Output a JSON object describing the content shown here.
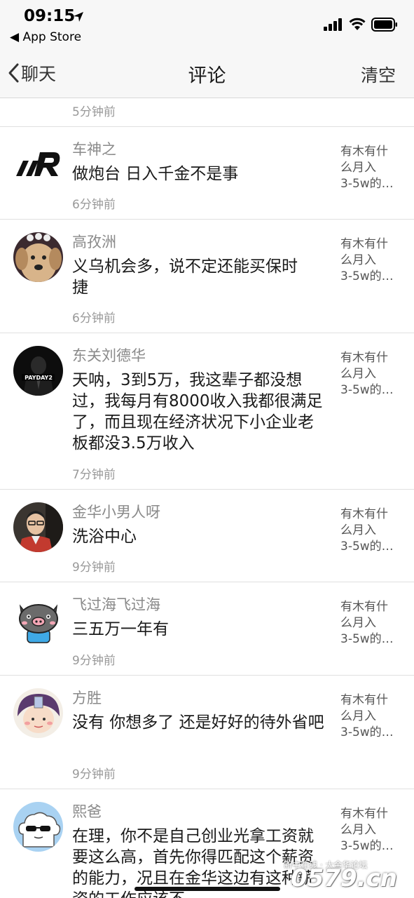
{
  "status": {
    "time": "09:15",
    "back_app": "◀ App Store"
  },
  "nav": {
    "back_label": "聊天",
    "title": "评论",
    "action": "清空"
  },
  "partial_row": {
    "time": "5分钟前"
  },
  "comments": [
    {
      "name": "车神之",
      "content": "做炮台 日入千金不是事",
      "time": "6分钟前",
      "ref": [
        "有木有什",
        "么月入",
        "3-5w的…"
      ]
    },
    {
      "name": "高孜洲",
      "content": "义乌机会多，说不定还能买保时捷",
      "time": "6分钟前",
      "ref": [
        "有木有什",
        "么月入",
        "3-5w的…"
      ]
    },
    {
      "name": "东关刘德华",
      "content": "天呐，3到5万，我这辈子都没想过，我每月有8000收入我都很满足了，而且现在经济状况下小企业老板都没3.5万收入",
      "time": "7分钟前",
      "ref": [
        "有木有什",
        "么月入",
        "3-5w的…"
      ]
    },
    {
      "name": "金华小男人呀",
      "content": "洗浴中心",
      "time": "9分钟前",
      "ref": [
        "有木有什",
        "么月入",
        "3-5w的…"
      ]
    },
    {
      "name": "飞过海飞过海",
      "content": "三五万一年有",
      "time": "9分钟前",
      "ref": [
        "有木有什",
        "么月入",
        "3-5w的…"
      ]
    },
    {
      "name": "方胜",
      "content": "没有  你想多了 还是好好的待外省吧",
      "time": "9分钟前",
      "ref": [
        "有木有什",
        "么月入",
        "3-5w的…"
      ]
    },
    {
      "name": "熙爸",
      "content": "在理，你不是自己创业光拿工资就要这么高，首先你得匹配这个薪资的能力，况且在金华这边有这种薪资的工作应该不",
      "time": "",
      "ref": [
        "有木有什",
        "么月入",
        "3-5w的…"
      ]
    }
  ],
  "avatar_labels": {
    "payday": "PAYDAY2"
  },
  "watermark": {
    "small": "新中在线 · 大金华论坛",
    "big": "0579.cn"
  }
}
